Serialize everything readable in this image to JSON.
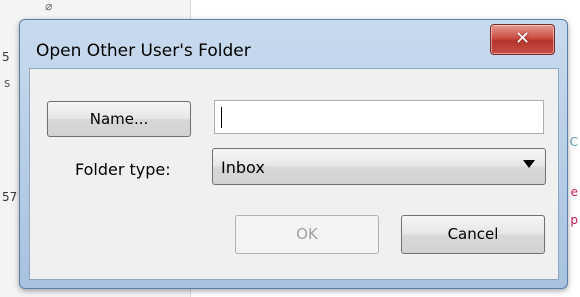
{
  "background": {
    "fragments": {
      "left_a": "5",
      "left_b": "s",
      "left_c": "57",
      "right_c": "C",
      "right_d": "e",
      "right_e": "p"
    }
  },
  "dialog": {
    "title": "Open Other User's Folder",
    "close_icon": "close-x-icon",
    "close_glyph": "✕",
    "name_button_label": "Name...",
    "name_input_value": "",
    "folder_type_label": "Folder type:",
    "folder_type_value": "Inbox",
    "dropdown_icon": "chevron-down-icon",
    "ok_label": "OK",
    "cancel_label": "Cancel"
  },
  "colors": {
    "title_bar": "#b7cde7",
    "close_button": "#c9493f",
    "client_bg": "#f0f0f0",
    "disabled_text": "#a0a0a0"
  }
}
